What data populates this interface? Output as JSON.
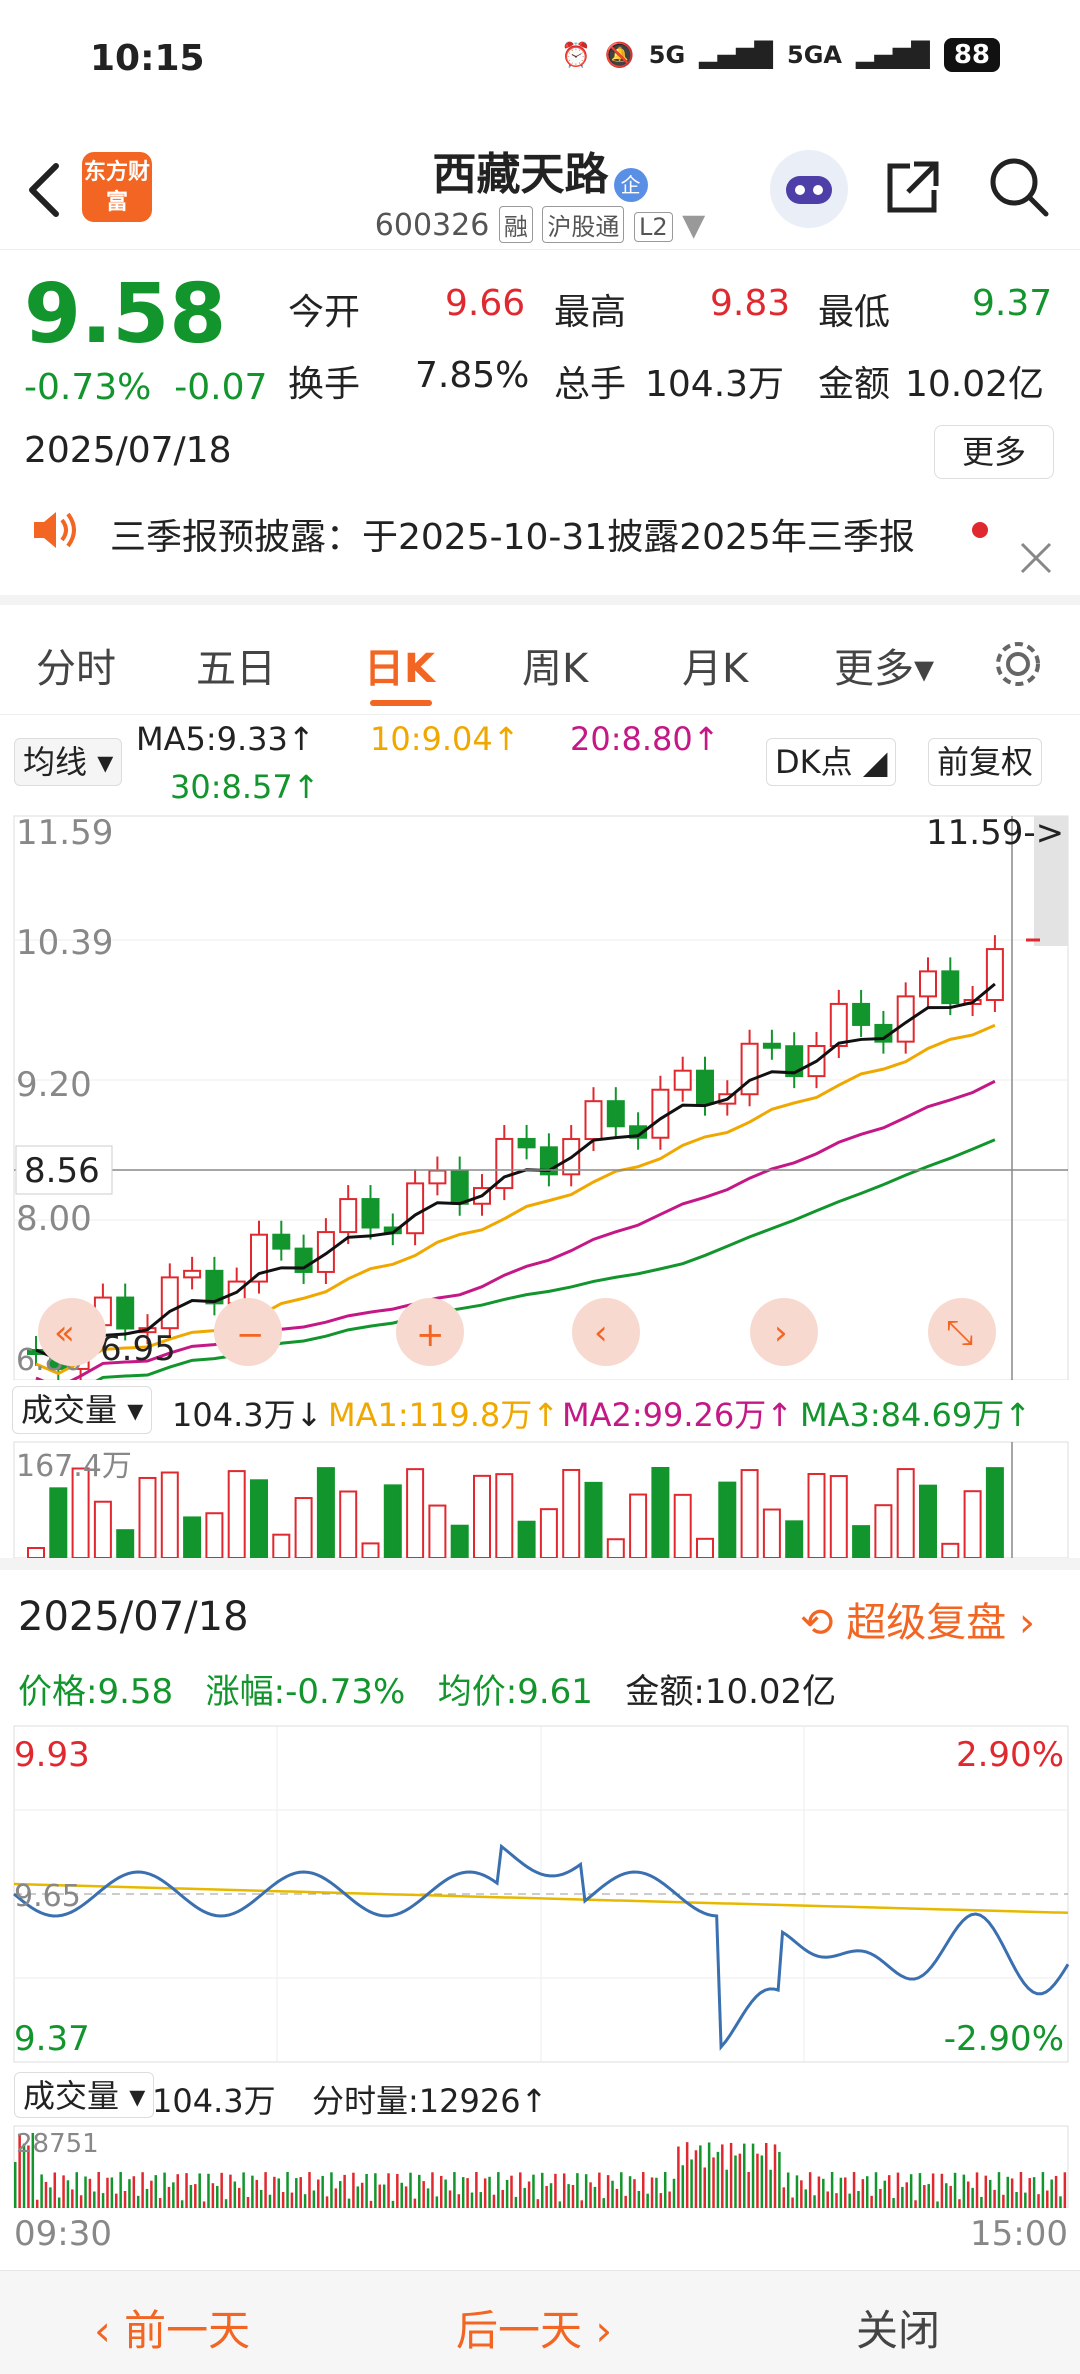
{
  "status": {
    "time": "10:15",
    "net1": "5G",
    "net2": "5GA",
    "battery": "88"
  },
  "header": {
    "logo": "东方财富",
    "name": "西藏天路",
    "name_badge": "企",
    "code": "600326",
    "tags": [
      "融",
      "沪股通",
      "L2"
    ]
  },
  "quote": {
    "price": "9.58",
    "pct": "-0.73%",
    "change": "-0.07",
    "date": "2025/07/18",
    "open_label": "今开",
    "open": "9.66",
    "high_label": "最高",
    "high": "9.83",
    "low_label": "最低",
    "low": "9.37",
    "turnover_label": "换手",
    "turnover": "7.85%",
    "vol_label": "总手",
    "vol": "104.3万",
    "amt_label": "金额",
    "amt": "10.02亿",
    "more": "更多"
  },
  "notice": "三季报预披露：于2025-10-31披露2025年三季报",
  "tabs": [
    "分时",
    "五日",
    "日K",
    "周K",
    "月K",
    "更多▾"
  ],
  "kline": {
    "ma_chip": "均线",
    "ma5": "MA5:9.33↑",
    "ma10": "10:9.04↑",
    "ma20": "20:8.80↑",
    "ma30": "30:8.57↑",
    "dk": "DK点",
    "fq": "前复权",
    "y_top": "11.59",
    "y_2": "10.39",
    "y_3": "9.20",
    "y_cross": "8.56",
    "y_4": "8.00",
    "y_bot": "6.80",
    "max_flag": "11.59->",
    "min_flag": "6.95"
  },
  "kvol": {
    "chip": "成交量",
    "vol": "104.3万↓",
    "ma1": "MA1:119.8万↑",
    "ma2": "MA2:99.26万↑",
    "ma3": "MA3:84.69万↑",
    "ymax": "167.4万"
  },
  "detail": {
    "date": "2025/07/18",
    "replay": "超级复盘",
    "price": "价格:9.58",
    "pct": "涨幅:-0.73%",
    "avg": "均价:9.61",
    "amt": "金额:10.02亿"
  },
  "intraday": {
    "hi": "9.93",
    "mid": "9.65",
    "lo": "9.37",
    "hi_pct": "2.90%",
    "lo_pct": "-2.90%",
    "vol_chip": "成交量",
    "vol": "104.3万",
    "fvol": "分时量:12926↑",
    "vmax": "28751",
    "t_start": "09:30",
    "t_end": "15:00"
  },
  "nav": {
    "prev": "前一天",
    "next": "后一天",
    "close": "关闭"
  },
  "colors": {
    "accent": "#f26522",
    "up": "#e0292f",
    "down": "#12952c"
  }
}
